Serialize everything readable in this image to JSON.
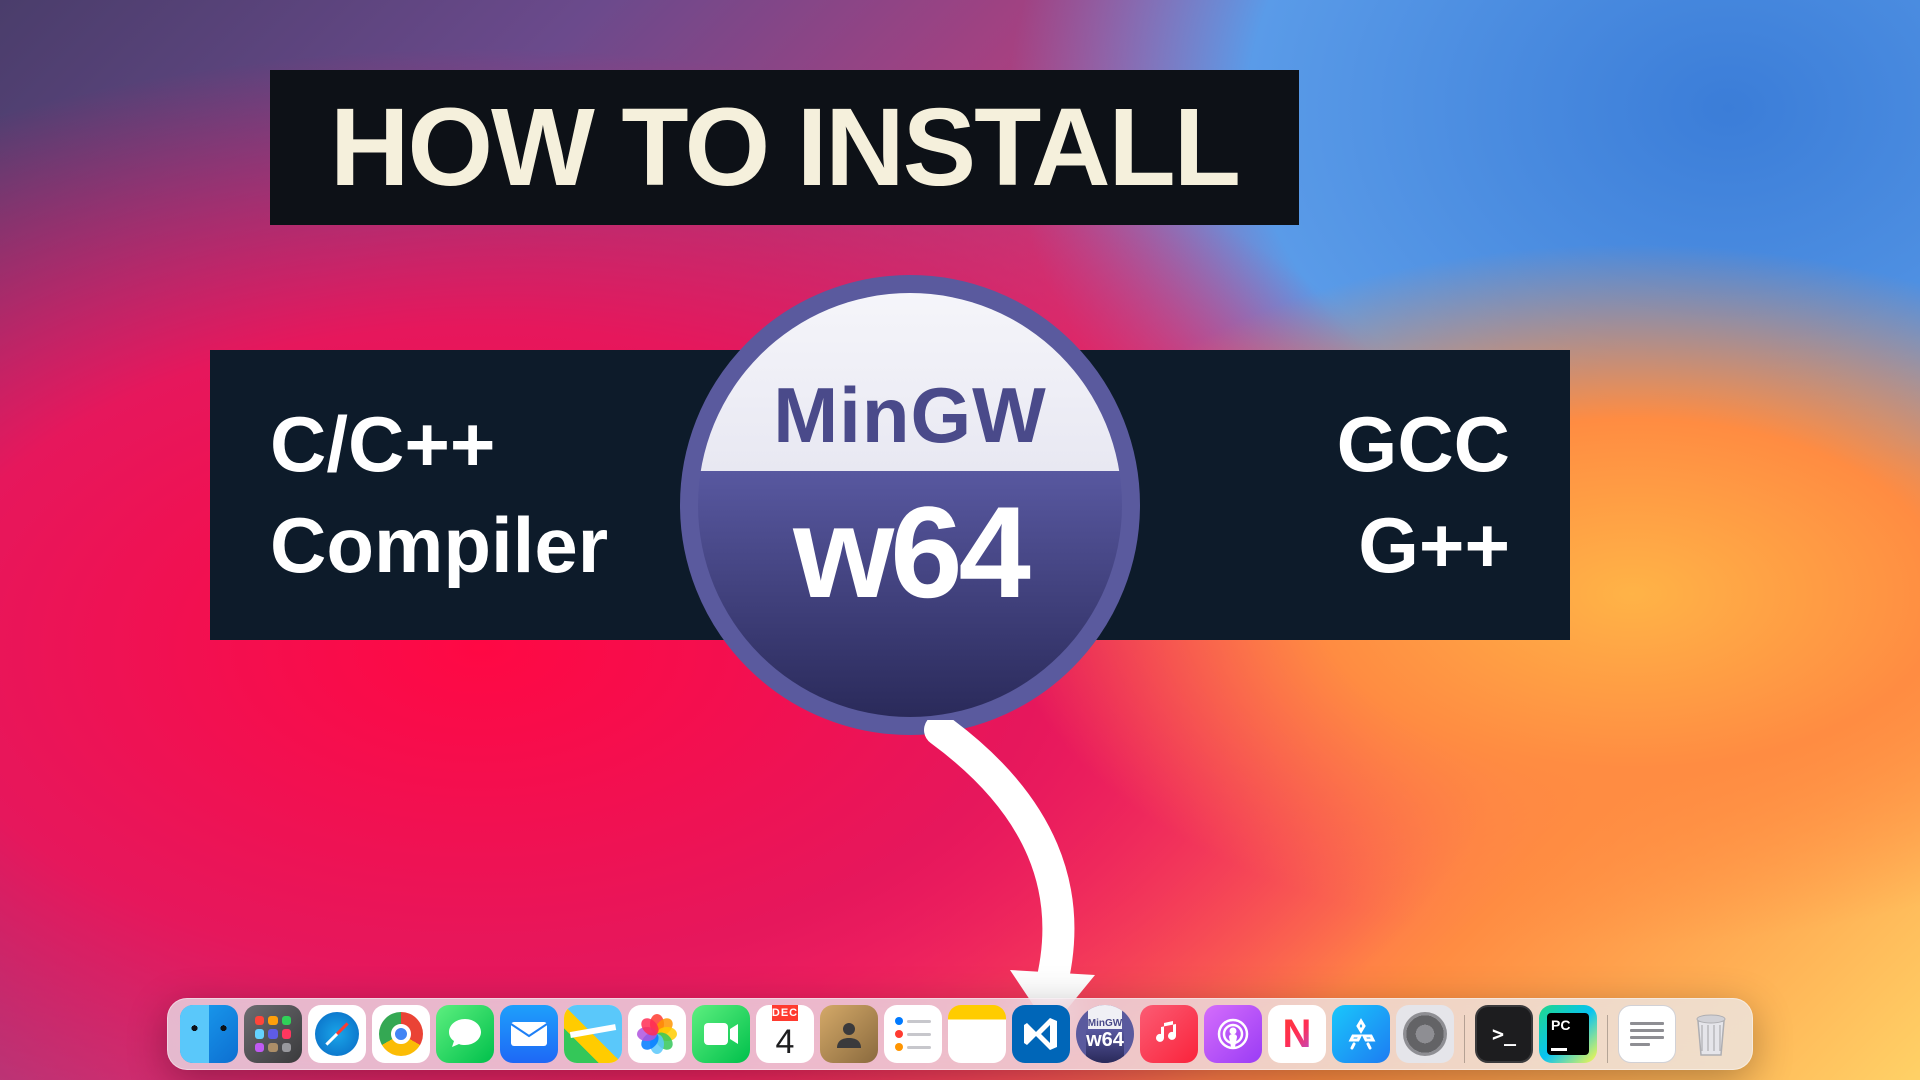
{
  "title": "HOW TO INSTALL",
  "leftText": {
    "line1": "C/C++",
    "line2": "Compiler"
  },
  "rightText": {
    "line1": "GCC",
    "line2": "G++"
  },
  "logo": {
    "top": "MinGW",
    "bottom": "w64"
  },
  "calendar": {
    "month": "DEC",
    "day": "4"
  },
  "dockIcons": [
    {
      "name": "finder"
    },
    {
      "name": "launchpad"
    },
    {
      "name": "safari"
    },
    {
      "name": "chrome"
    },
    {
      "name": "messages"
    },
    {
      "name": "mail"
    },
    {
      "name": "maps"
    },
    {
      "name": "photos"
    },
    {
      "name": "facetime"
    },
    {
      "name": "calendar"
    },
    {
      "name": "contacts"
    },
    {
      "name": "reminders"
    },
    {
      "name": "notes"
    },
    {
      "name": "vscode"
    },
    {
      "name": "mingw"
    },
    {
      "name": "music"
    },
    {
      "name": "podcasts"
    },
    {
      "name": "news"
    },
    {
      "name": "appstore"
    },
    {
      "name": "settings"
    },
    {
      "name": "terminal"
    },
    {
      "name": "pycharm"
    },
    {
      "name": "textedit"
    },
    {
      "name": "trash"
    }
  ]
}
